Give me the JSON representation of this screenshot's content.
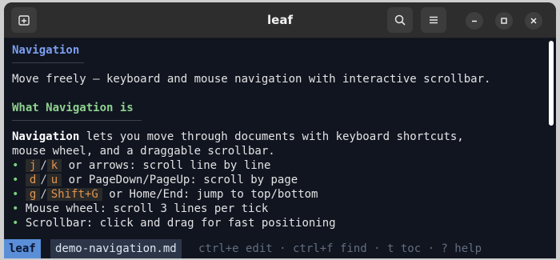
{
  "window": {
    "title": "leaf",
    "new_tab_icon": "new-tab-icon",
    "search_icon": "search-icon",
    "menu_icon": "hamburger-menu-icon",
    "minimize_icon": "minimize-icon",
    "maximize_icon": "maximize-icon",
    "close_icon": "close-icon"
  },
  "doc": {
    "heading1": "Navigation",
    "intro": "Move freely — keyboard and mouse navigation with interactive scrollbar.",
    "heading2": "What Navigation is",
    "para_bold": "Navigation",
    "para_rest1": " lets you move through documents with keyboard shortcuts,",
    "para_line2": "mouse wheel, and a draggable scrollbar.",
    "bullet": "•",
    "items": [
      {
        "k1": "j",
        "slash": "/",
        "k2": "k",
        "text": " or arrows: scroll line by line"
      },
      {
        "k1": "d",
        "slash": "/",
        "k2": "u",
        "text": " or PageDown/PageUp: scroll by page"
      },
      {
        "k1": "g",
        "slash": "/",
        "k2": "Shift+G",
        "text": " or Home/End: jump to top/bottom"
      }
    ],
    "item_wheel": " Mouse wheel: scroll 3 lines per tick",
    "item_scrollbar": " Scrollbar: click and drag for fast positioning"
  },
  "status": {
    "app": "leaf",
    "file": "demo-navigation.md",
    "help": "ctrl+e edit · ctrl+f find · t toc · ? help"
  },
  "colors": {
    "heading_blue": "#7d9ff0",
    "heading_green": "#8fd18f",
    "key_orange": "#e0944f",
    "status_accent": "#5a8fd8"
  }
}
